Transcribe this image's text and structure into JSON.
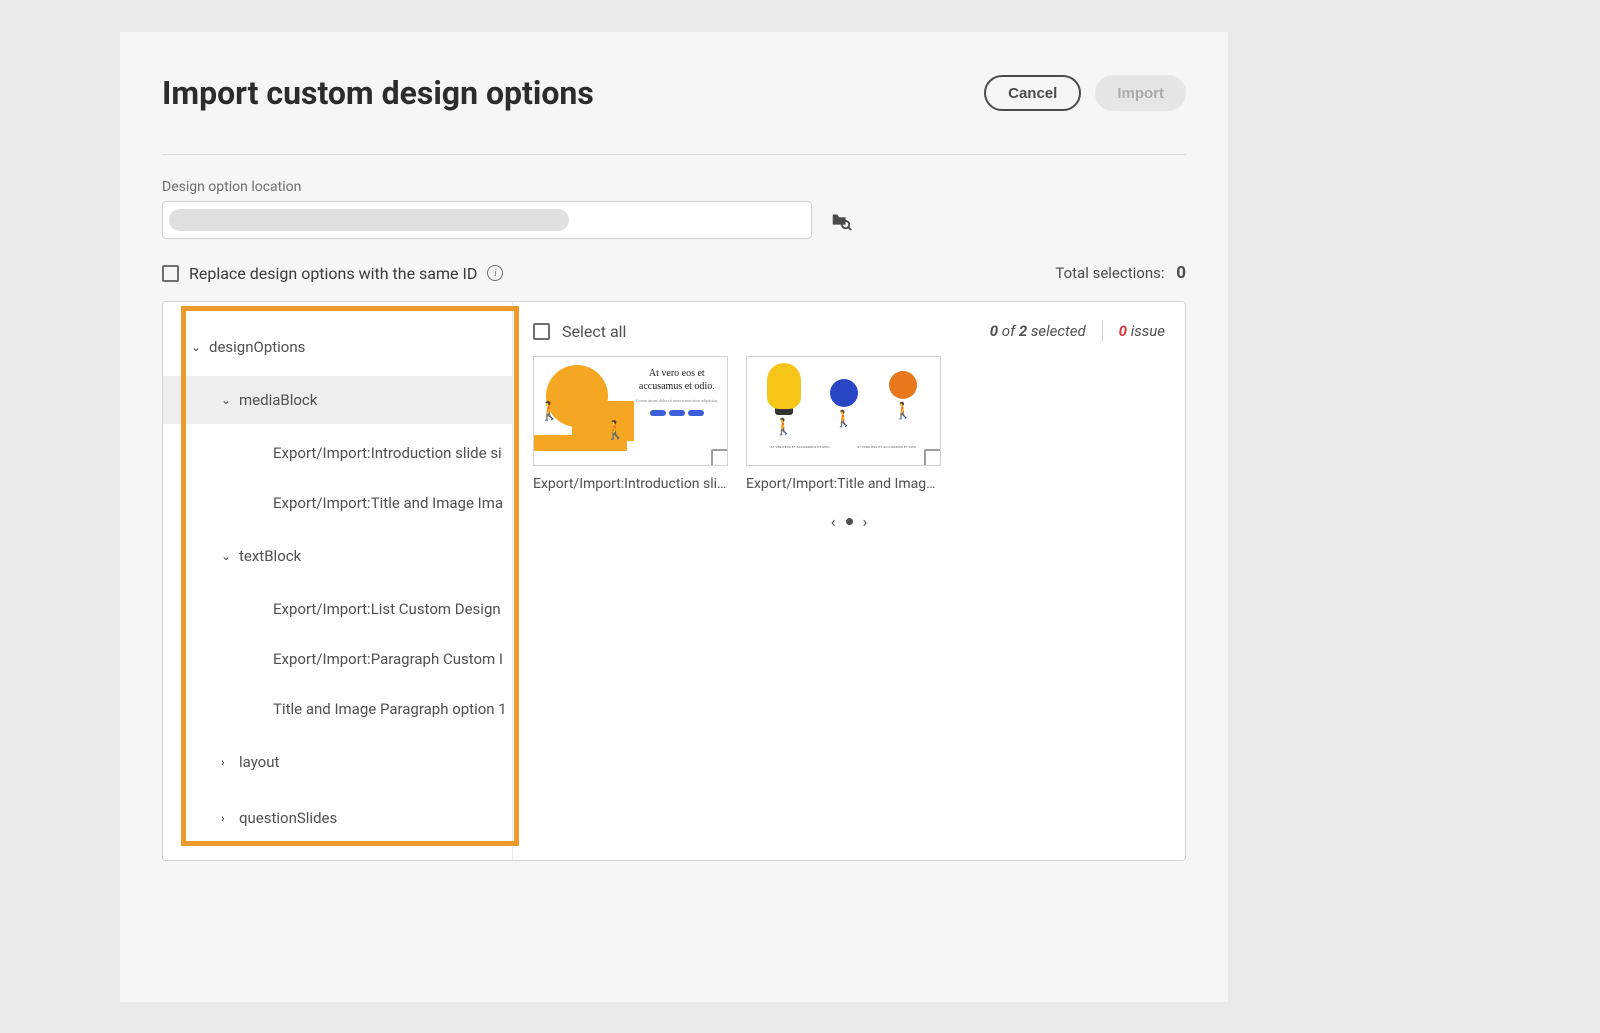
{
  "header": {
    "title": "Import custom design options",
    "cancel_label": "Cancel",
    "import_label": "Import"
  },
  "location": {
    "label": "Design option location"
  },
  "replace": {
    "label": "Replace design options with the same ID"
  },
  "totals": {
    "label": "Total selections:",
    "count": "0"
  },
  "tree": {
    "root": "designOptions",
    "nodes": [
      {
        "label": "mediaBlock",
        "expanded": true,
        "selected": true,
        "children": [
          "Export/Import:Introduction slide si",
          "Export/Import:Title and Image Ima"
        ]
      },
      {
        "label": "textBlock",
        "expanded": true,
        "selected": false,
        "children": [
          "Export/Import:List Custom Design",
          "Export/Import:Paragraph Custom I",
          "Title and Image Paragraph option 1"
        ]
      },
      {
        "label": "layout",
        "expanded": false
      },
      {
        "label": "questionSlides",
        "expanded": false
      }
    ]
  },
  "preview": {
    "select_all_label": "Select all",
    "selected_count": "0",
    "selected_total": "2",
    "selected_suffix": "selected",
    "of_word": "of",
    "issue_count": "0",
    "issue_label": "issue",
    "thumb1_text": "At vero eos et accusamus et odio.",
    "cards": [
      {
        "label": "Export/Import:Introduction slid..."
      },
      {
        "label": "Export/Import:Title and Image I..."
      }
    ],
    "mini_text": "AT VERO EOS ET ACCUSAMUS ET ODIO"
  }
}
